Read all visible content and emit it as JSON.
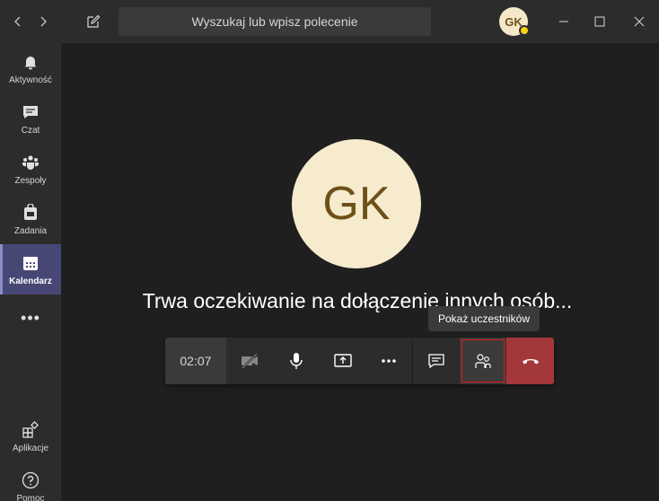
{
  "titlebar": {
    "search_placeholder": "Wyszukaj lub wpisz polecenie",
    "user_initials": "GK"
  },
  "rail": {
    "items": [
      {
        "label": "Aktywność",
        "icon": "bell-icon"
      },
      {
        "label": "Czat",
        "icon": "chat-icon"
      },
      {
        "label": "Zespoły",
        "icon": "teams-icon"
      },
      {
        "label": "Zadania",
        "icon": "assignments-icon"
      },
      {
        "label": "Kalendarz",
        "icon": "calendar-icon",
        "active": true
      }
    ],
    "more": "•••",
    "bottom": [
      {
        "label": "Aplikacje",
        "icon": "apps-icon"
      },
      {
        "label": "Pomoc",
        "icon": "help-icon"
      }
    ]
  },
  "stage": {
    "avatar_initials": "GK",
    "waiting_text": "Trwa oczekiwanie na dołączenie innych osób..."
  },
  "callbar": {
    "timer": "02:07",
    "tooltip": "Pokaż uczestników",
    "buttons": [
      "camera-off-icon",
      "microphone-icon",
      "share-icon",
      "more-icon",
      "chat-icon",
      "participants-icon",
      "hangup-icon"
    ]
  },
  "colors": {
    "accent": "#464775",
    "hangup": "#a4373a",
    "avatar_bg": "#f6ebcd",
    "avatar_fg": "#6e5018",
    "presence_away": "#fcd116"
  }
}
